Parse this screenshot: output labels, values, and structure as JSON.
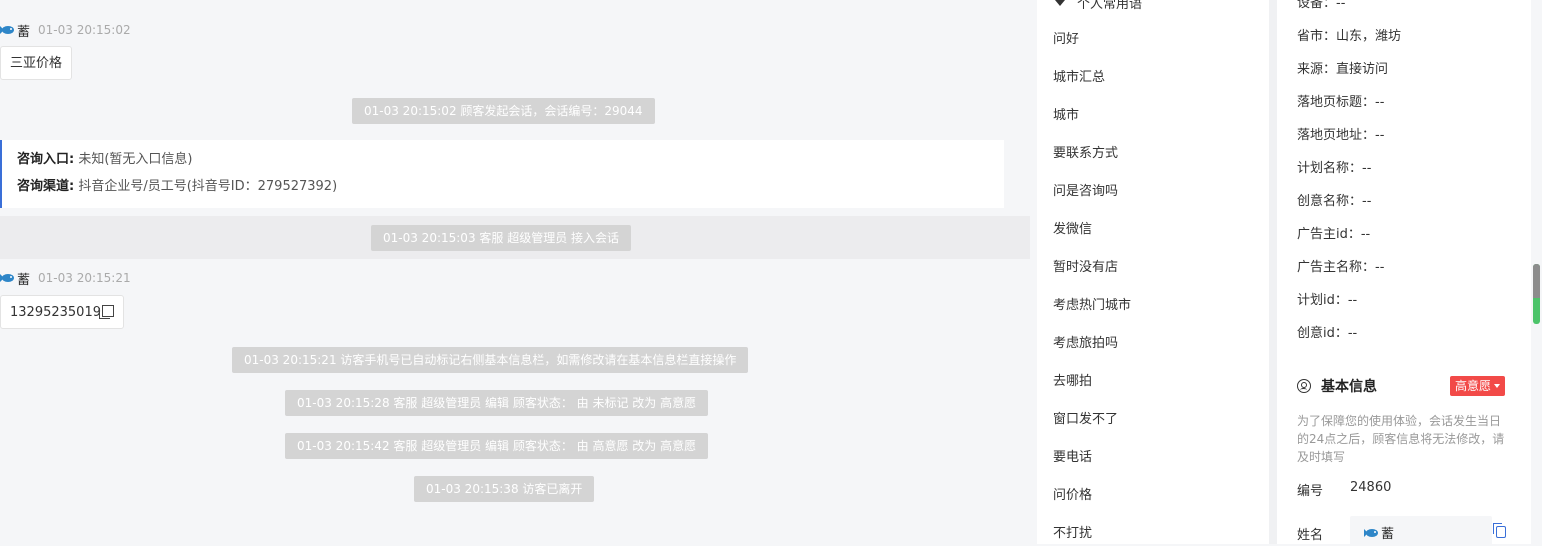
{
  "chat": {
    "msg1": {
      "sender": "蓄",
      "time": "01-03 20:15:02",
      "text": "三亚价格"
    },
    "sys_start": "01-03 20:15:02 顾客发起会话，会话编号：29044",
    "entry": {
      "label1": "咨询入口:",
      "value1": "未知(暂无入口信息)",
      "label2": "咨询渠道:",
      "value2": "抖音企业号/员工号(抖音号ID：279527392)"
    },
    "sys_join": "01-03 20:15:03 客服 超级管理员 接入会话",
    "msg2": {
      "sender": "蓄",
      "time": "01-03 20:15:21",
      "text": "13295235019"
    },
    "sys_events": [
      "01-03 20:15:21 访客手机号已自动标记右侧基本信息栏，如需修改请在基本信息栏直接操作",
      "01-03 20:15:28 客服 超级管理员 编辑 顾客状态： 由 未标记 改为 高意愿",
      "01-03 20:15:42 客服 超级管理员 编辑 顾客状态： 由 高意愿 改为 高意愿",
      "01-03 20:15:38 访客已离开"
    ]
  },
  "phrases": {
    "group_title": "个人常用语",
    "items": [
      "问好",
      "城市汇总",
      "城市",
      "要联系方式",
      "问是咨询吗",
      "发微信",
      "暂时没有店",
      "考虑热门城市",
      "考虑旅拍吗",
      "去哪拍",
      "窗口发不了",
      "要电话",
      "问价格",
      "不打扰"
    ]
  },
  "info": {
    "fields": [
      "设备：--",
      "省市：山东，潍坊",
      "来源：直接访问",
      "落地页标题：--",
      "落地页地址：--",
      "计划名称：--",
      "创意名称：--",
      "广告主id：--",
      "广告主名称：--",
      "计划id：--",
      "创意id：--"
    ],
    "section_title": "基本信息",
    "intent_badge": "高意愿",
    "notice": "为了保障您的使用体验，会话发生当日的24点之后，顾客信息将无法修改，请及时填写",
    "number_label": "编号",
    "number_value": "24860",
    "name_label": "姓名",
    "name_value": "蓄"
  },
  "colors": {
    "accent": "#3a6fd8",
    "badge": "#f24a48",
    "scroll_green": "#4cc46a"
  }
}
